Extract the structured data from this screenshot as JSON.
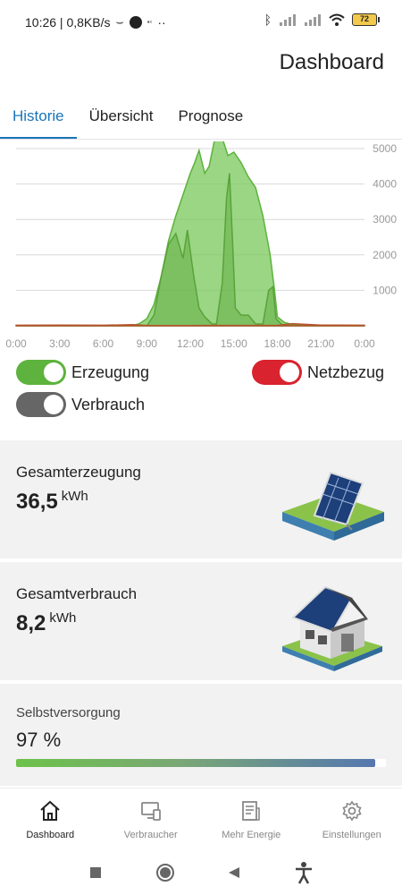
{
  "status_bar": {
    "time_speed": "10:26 | 0,8KB/s",
    "battery": "72"
  },
  "header": {
    "title": "Dashboard"
  },
  "tabs": [
    {
      "label": "Historie",
      "active": true
    },
    {
      "label": "Übersicht",
      "active": false
    },
    {
      "label": "Prognose",
      "active": false
    }
  ],
  "chart_data": {
    "type": "area",
    "x_ticks": [
      "0:00",
      "3:00",
      "6:00",
      "9:00",
      "12:00",
      "15:00",
      "18:00",
      "21:00",
      "0:00"
    ],
    "y_ticks": [
      "1000",
      "2000",
      "3000",
      "4000",
      "5000"
    ],
    "ylim": [
      0,
      5000
    ],
    "xlim_hours": [
      0,
      24
    ],
    "grid": true,
    "series": [
      {
        "name": "Erzeugung",
        "color": "#5db33d",
        "points": [
          [
            0,
            0
          ],
          [
            8,
            0
          ],
          [
            8.5,
            60
          ],
          [
            9,
            200
          ],
          [
            9.5,
            600
          ],
          [
            10,
            1400
          ],
          [
            10.5,
            2400
          ],
          [
            11,
            3100
          ],
          [
            11.5,
            3700
          ],
          [
            12,
            4300
          ],
          [
            12.3,
            4600
          ],
          [
            12.6,
            4950
          ],
          [
            13,
            4300
          ],
          [
            13.3,
            4500
          ],
          [
            13.7,
            5300
          ],
          [
            14.2,
            5300
          ],
          [
            14.6,
            4800
          ],
          [
            15,
            4900
          ],
          [
            15.5,
            4600
          ],
          [
            16,
            4200
          ],
          [
            16.5,
            3900
          ],
          [
            17,
            3100
          ],
          [
            17.5,
            2000
          ],
          [
            17.8,
            1000
          ],
          [
            18,
            250
          ],
          [
            18.5,
            90
          ],
          [
            19,
            40
          ],
          [
            20,
            0
          ],
          [
            24,
            0
          ]
        ]
      },
      {
        "name": "Verbrauch",
        "color": "#5db33d",
        "points": [
          [
            0,
            0
          ],
          [
            9,
            0
          ],
          [
            9.5,
            300
          ],
          [
            10,
            1400
          ],
          [
            10.5,
            2300
          ],
          [
            11,
            2600
          ],
          [
            11.5,
            1900
          ],
          [
            11.8,
            2700
          ],
          [
            12.2,
            1500
          ],
          [
            12.6,
            500
          ],
          [
            13,
            250
          ],
          [
            13.5,
            50
          ],
          [
            13.8,
            50
          ],
          [
            14.2,
            1200
          ],
          [
            14.5,
            3600
          ],
          [
            14.7,
            4300
          ],
          [
            14.9,
            2500
          ],
          [
            15.1,
            500
          ],
          [
            15.5,
            300
          ],
          [
            16,
            300
          ],
          [
            16.5,
            50
          ],
          [
            17,
            50
          ],
          [
            17.4,
            1000
          ],
          [
            17.7,
            1100
          ],
          [
            17.9,
            200
          ],
          [
            18.3,
            40
          ],
          [
            19,
            0
          ],
          [
            24,
            0
          ]
        ]
      },
      {
        "name": "Netzbezug",
        "color": "#c0392b",
        "points": [
          [
            0,
            15
          ],
          [
            3,
            20
          ],
          [
            6,
            15
          ],
          [
            8,
            30
          ],
          [
            9,
            10
          ],
          [
            12,
            5
          ],
          [
            13.5,
            10
          ],
          [
            18,
            10
          ],
          [
            19,
            60
          ],
          [
            21,
            20
          ],
          [
            24,
            15
          ]
        ]
      }
    ]
  },
  "toggles": {
    "erzeugung": {
      "label": "Erzeugung",
      "color": "#5db33d"
    },
    "netzbezug": {
      "label": "Netzbezug",
      "color": "#d9232e"
    },
    "verbrauch": {
      "label": "Verbrauch",
      "color": "#666666"
    }
  },
  "cards": {
    "generation": {
      "title": "Gesamterzeugung",
      "value": "36,5",
      "unit": "kWh"
    },
    "consumption": {
      "title": "Gesamtverbrauch",
      "value": "8,2",
      "unit": "kWh"
    },
    "self_supply": {
      "title": "Selbstversorgung",
      "value": "97 %",
      "percent": 97
    }
  },
  "bottom_nav": [
    {
      "label": "Dashboard",
      "icon": "home-icon",
      "active": true
    },
    {
      "label": "Verbraucher",
      "icon": "devices-icon",
      "active": false
    },
    {
      "label": "Mehr Energie",
      "icon": "document-icon",
      "active": false
    },
    {
      "label": "Einstellungen",
      "icon": "gear-icon",
      "active": false
    }
  ]
}
